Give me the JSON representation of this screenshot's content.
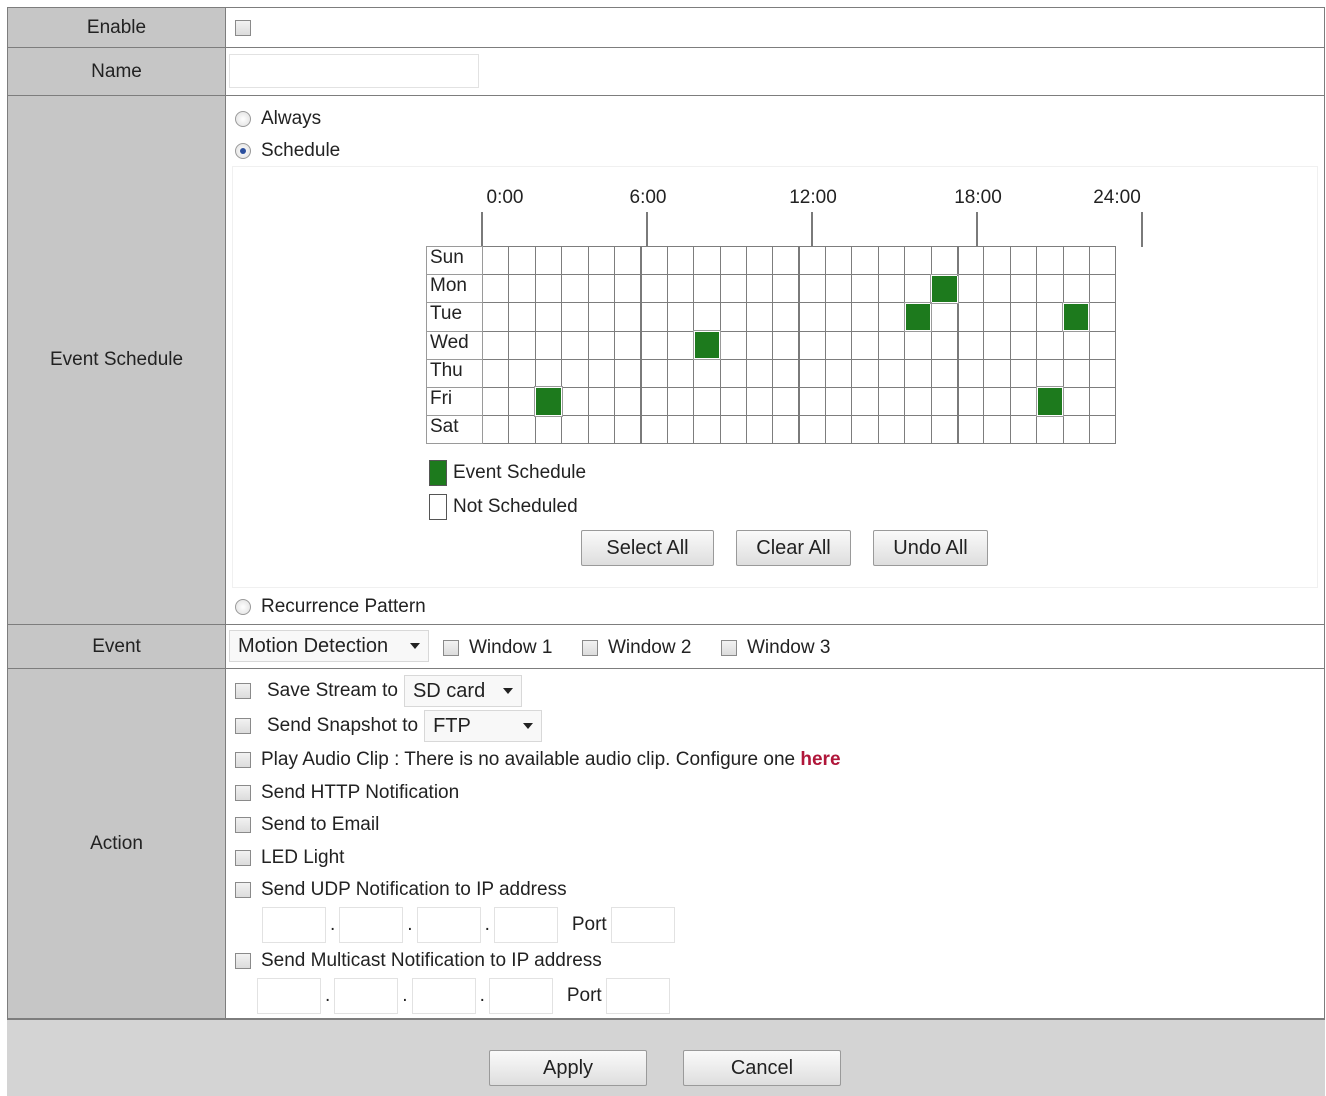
{
  "labels": {
    "enable": "Enable",
    "name": "Name",
    "event_schedule": "Event Schedule",
    "event": "Event",
    "action": "Action"
  },
  "name_value": "",
  "schedule": {
    "always": "Always",
    "schedule": "Schedule",
    "recurrence": "Recurrence Pattern",
    "selected_mode": "Schedule",
    "hours": [
      "0:00",
      "6:00",
      "12:00",
      "18:00",
      "24:00"
    ],
    "days": [
      "Sun",
      "Mon",
      "Tue",
      "Wed",
      "Thu",
      "Fri",
      "Sat"
    ],
    "selected_cells": [
      {
        "day": "Mon",
        "slot": 17
      },
      {
        "day": "Tue",
        "slot": 16
      },
      {
        "day": "Tue",
        "slot": 22
      },
      {
        "day": "Wed",
        "slot": 8
      },
      {
        "day": "Fri",
        "slot": 2
      },
      {
        "day": "Fri",
        "slot": 21
      }
    ],
    "legend_scheduled": "Event Schedule",
    "legend_not_scheduled": "Not Scheduled",
    "scheduled_color": "#1d7a1d",
    "select_all": "Select All",
    "clear_all": "Clear All",
    "undo_all": "Undo All"
  },
  "event": {
    "type": "Motion Detection",
    "window1": "Window 1",
    "window2": "Window 2",
    "window3": "Window 3"
  },
  "action": {
    "save_stream": "Save Stream to",
    "save_stream_target": "SD card",
    "send_snapshot": "Send Snapshot to",
    "send_snapshot_target": "FTP",
    "play_audio": "Play Audio Clip : There is no available audio clip. Configure one",
    "here_link": "here",
    "http": "Send HTTP Notification",
    "email": "Send to Email",
    "led": "LED Light",
    "udp": "Send UDP Notification to IP address",
    "multicast": "Send Multicast Notification to IP address",
    "port_label": "Port",
    "ip_separator": "."
  },
  "footer": {
    "apply": "Apply",
    "cancel": "Cancel"
  }
}
